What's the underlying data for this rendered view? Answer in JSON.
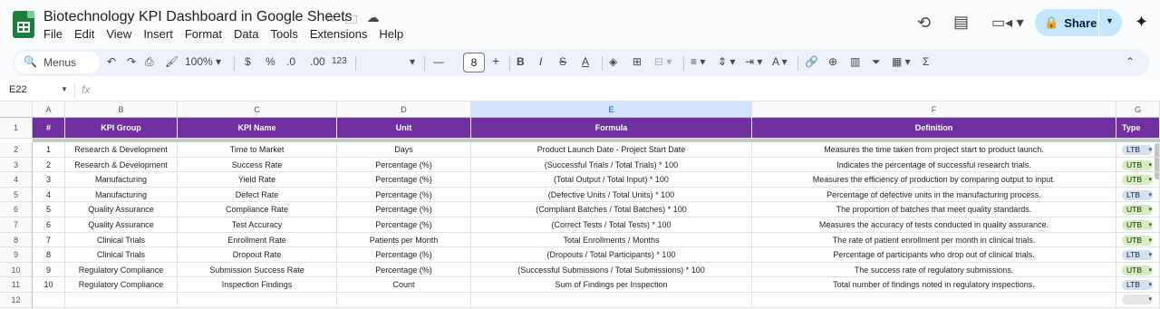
{
  "app": {
    "title": "Biotechnology KPI Dashboard in Google Sheets",
    "menu": [
      "File",
      "Edit",
      "View",
      "Insert",
      "Format",
      "Data",
      "Tools",
      "Extensions",
      "Help"
    ],
    "share_label": "Share"
  },
  "toolbar": {
    "menus_label": "Menus",
    "zoom": "100%",
    "currency": "$",
    "percent": "%",
    "dec_decrease": ".0",
    "dec_increase": ".00",
    "number_format": "123",
    "font_size": "8"
  },
  "formula_bar": {
    "cell_ref": "E22",
    "fx": "fx"
  },
  "sheet": {
    "columns": [
      "A",
      "B",
      "C",
      "D",
      "E",
      "F",
      "G"
    ],
    "selected_column": "E",
    "row_numbers": [
      "1",
      "2",
      "3",
      "4",
      "5",
      "6",
      "7",
      "8",
      "9",
      "10",
      "11",
      "12"
    ],
    "headers": [
      "#",
      "KPI Group",
      "KPI Name",
      "Unit",
      "Formula",
      "Definition",
      "Type"
    ],
    "rows": [
      [
        "1",
        "Research & Development",
        "Time to Market",
        "Days",
        "Product Launch Date - Project Start Date",
        "Measures the time taken from project start to product launch.",
        "LTB"
      ],
      [
        "2",
        "Research & Development",
        "Success Rate",
        "Percentage (%)",
        "(Successful Trials / Total Trials) * 100",
        "Indicates the percentage of successful research trials.",
        "UTB"
      ],
      [
        "3",
        "Manufacturing",
        "Yield Rate",
        "Percentage (%)",
        "(Total Output / Total Input) * 100",
        "Measures the efficiency of production by comparing output to input.",
        "UTB"
      ],
      [
        "4",
        "Manufacturing",
        "Defect Rate",
        "Percentage (%)",
        "(Defective Units / Total Units) * 100",
        "Percentage of defective units in the manufacturing process.",
        "LTB"
      ],
      [
        "5",
        "Quality Assurance",
        "Compliance Rate",
        "Percentage (%)",
        "(Compliant Batches / Total Batches) * 100",
        "The proportion of batches that meet quality standards.",
        "UTB"
      ],
      [
        "6",
        "Quality Assurance",
        "Test Accuracy",
        "Percentage (%)",
        "(Correct Tests / Total Tests) * 100",
        "Measures the accuracy of tests conducted in quality assurance.",
        "UTB"
      ],
      [
        "7",
        "Clinical Trials",
        "Enrollment Rate",
        "Patients per Month",
        "Total Enrollments / Months",
        "The rate of patient enrollment per month in clinical trials.",
        "UTB"
      ],
      [
        "8",
        "Clinical Trials",
        "Dropout Rate",
        "Percentage (%)",
        "(Dropouts / Total Participants) * 100",
        "Percentage of participants who drop out of clinical trials.",
        "LTB"
      ],
      [
        "9",
        "Regulatory Compliance",
        "Submission Success Rate",
        "Percentage (%)",
        "(Successful Submissions / Total Submissions) * 100",
        "The success rate of regulatory submissions.",
        "UTB"
      ],
      [
        "10",
        "Regulatory Compliance",
        "Inspection Findings",
        "Count",
        "Sum of Findings per Inspection",
        "Total number of findings noted in regulatory inspections.",
        "LTB"
      ]
    ],
    "chip_colors": {
      "LTB": "#d0e1f5",
      "UTB": "#d4edbc",
      "empty": "#e6e6e6"
    },
    "header_color": "#7030a0"
  }
}
